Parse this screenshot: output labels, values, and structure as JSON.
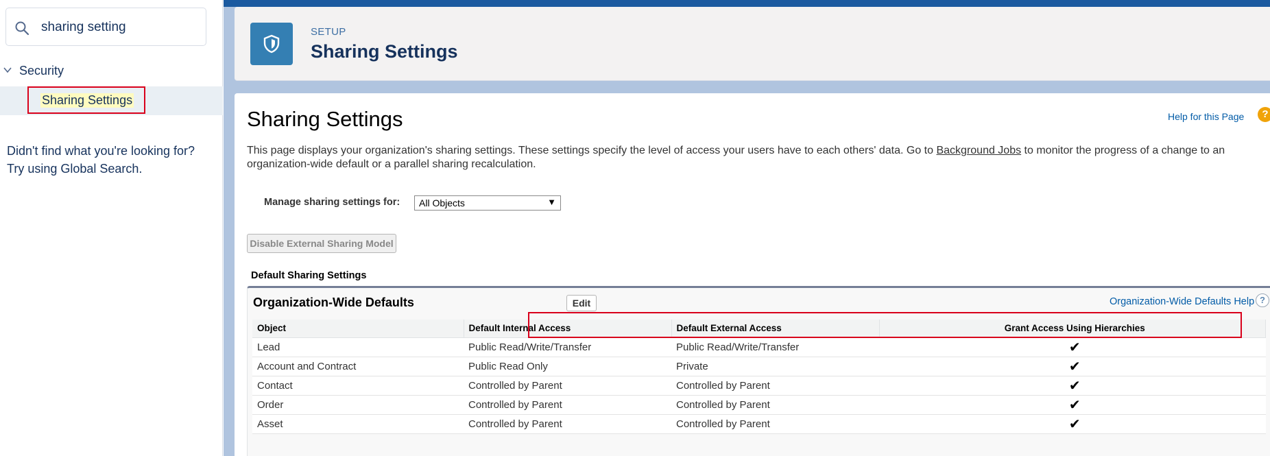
{
  "sidebar": {
    "search": {
      "value": "sharing setting",
      "icon": "search-icon"
    },
    "tree": {
      "group_label": "Security",
      "item_label": "Sharing Settings"
    },
    "no_results": {
      "line1": "Didn't find what you're looking for?",
      "line2": "Try using Global Search."
    }
  },
  "header": {
    "eyebrow": "SETUP",
    "title": "Sharing Settings",
    "icon": "shield-icon"
  },
  "content": {
    "page_title": "Sharing Settings",
    "help_link": "Help for this Page",
    "help_icon": "?",
    "description_part1": "This page displays your organization's sharing settings. These settings specify the level of access your users have to each others' data. Go to ",
    "description_link": "Background Jobs",
    "description_part2": " to monitor the progress of a change to an organization-wide default or a parallel sharing recalculation.",
    "manage_label": "Manage sharing settings for:",
    "manage_select_value": "All Objects",
    "manage_select_arrow": "▼",
    "disable_button": "Disable External Sharing Model",
    "section_label": "Default Sharing Settings",
    "owd": {
      "title": "Organization-Wide Defaults",
      "edit_button": "Edit",
      "help_link": "Organization-Wide Defaults Help",
      "help_icon": "?",
      "columns": [
        "Object",
        "Default Internal Access",
        "Default External Access",
        "Grant Access Using Hierarchies"
      ],
      "rows": [
        [
          "Lead",
          "Public Read/Write/Transfer",
          "Public Read/Write/Transfer",
          "✔"
        ],
        [
          "Account and Contract",
          "Public Read Only",
          "Private",
          "✔"
        ],
        [
          "Contact",
          "Controlled by Parent",
          "Controlled by Parent",
          "✔"
        ],
        [
          "Order",
          "Controlled by Parent",
          "Controlled by Parent",
          "✔"
        ],
        [
          "Asset",
          "Controlled by Parent",
          "Controlled by Parent",
          "✔"
        ]
      ]
    }
  },
  "colors": {
    "highlight_border": "#d9001b",
    "brand_blue": "#347fb3",
    "link_blue": "#015ba7"
  }
}
